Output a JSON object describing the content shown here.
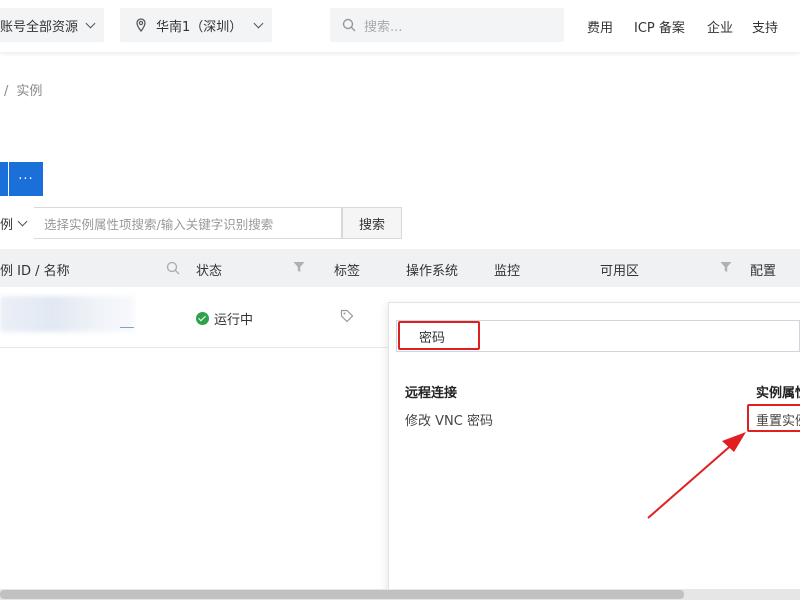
{
  "topbar": {
    "account_scope": "账号全部资源",
    "region": "华南1（深圳）",
    "search_placeholder": "搜索...",
    "links": [
      "费用",
      "ICP 备案",
      "企业",
      "支持"
    ]
  },
  "breadcrumb": {
    "current": "实例"
  },
  "toolbar": {
    "more_label": "···"
  },
  "filter": {
    "select_label": "例",
    "placeholder": "选择实例属性项搜索/输入关键字识别搜索",
    "search_button": "搜索"
  },
  "table": {
    "headers": {
      "id_name": "例 ID / 名称",
      "status": "状态",
      "tags": "标签",
      "os": "操作系统",
      "monitor": "监控",
      "zone": "可用区",
      "config": "配置"
    },
    "row": {
      "status": "运行中"
    }
  },
  "popover": {
    "search_value": "密码",
    "groups": [
      {
        "title": "远程连接",
        "items": [
          "修改 VNC 密码"
        ]
      },
      {
        "title": "实例属性",
        "items": [
          "重置实例"
        ]
      }
    ]
  },
  "colors": {
    "primary": "#1a6fd9",
    "highlight": "#e02020",
    "running": "#2ea24a"
  }
}
